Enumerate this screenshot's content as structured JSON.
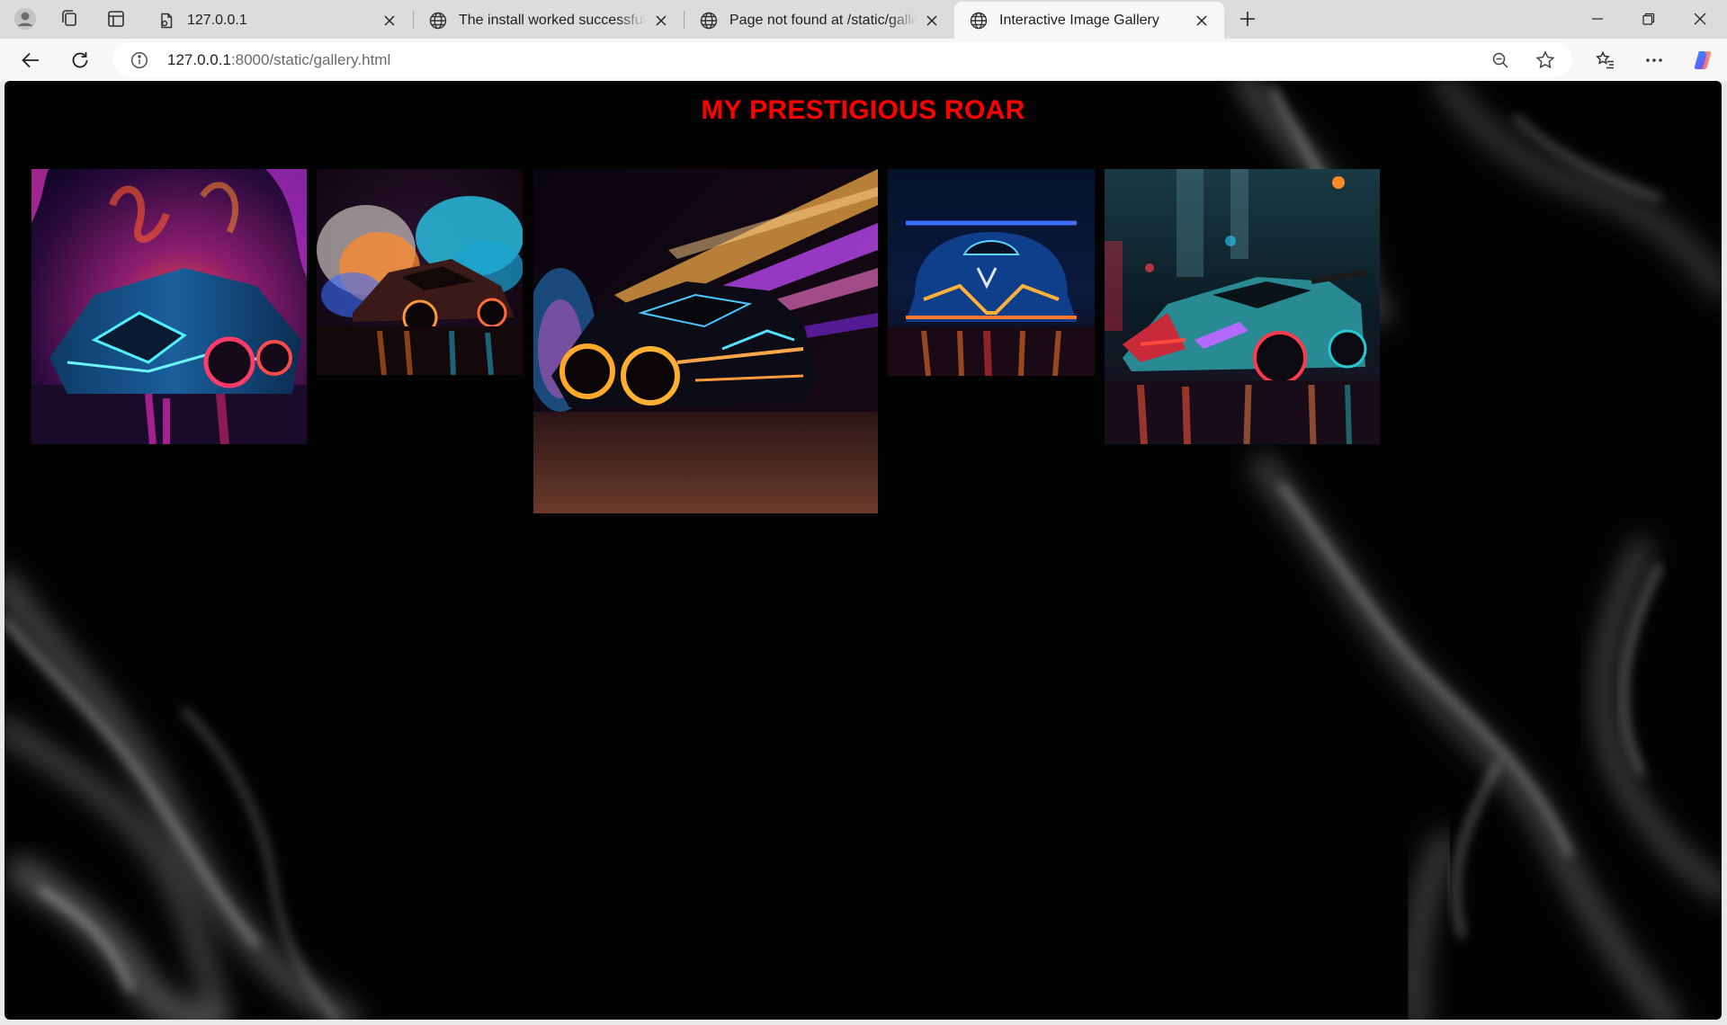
{
  "browser": {
    "tabs": [
      {
        "title": "127.0.0.1",
        "icon": "file-document-icon",
        "active": false
      },
      {
        "title": "The install worked successfully! Congratulations!",
        "icon": "globe-icon",
        "active": false
      },
      {
        "title": "Page not found at /static/gallery.html",
        "icon": "globe-icon",
        "active": false
      },
      {
        "title": "Interactive Image Gallery",
        "icon": "globe-icon",
        "active": true
      }
    ],
    "address": {
      "host": "127.0.0.1",
      "path": ":8000/static/gallery.html"
    }
  },
  "page": {
    "heading": "MY PRESTIGIOUS ROAR",
    "heading_color": "#ff0000",
    "background_color": "#030303",
    "gallery": [
      {
        "name": "neon sports car in flames"
      },
      {
        "name": "sports car with colored smoke"
      },
      {
        "name": "hypercar with light trails"
      },
      {
        "name": "neon race car front view"
      },
      {
        "name": "supercar on wet city street"
      }
    ]
  }
}
